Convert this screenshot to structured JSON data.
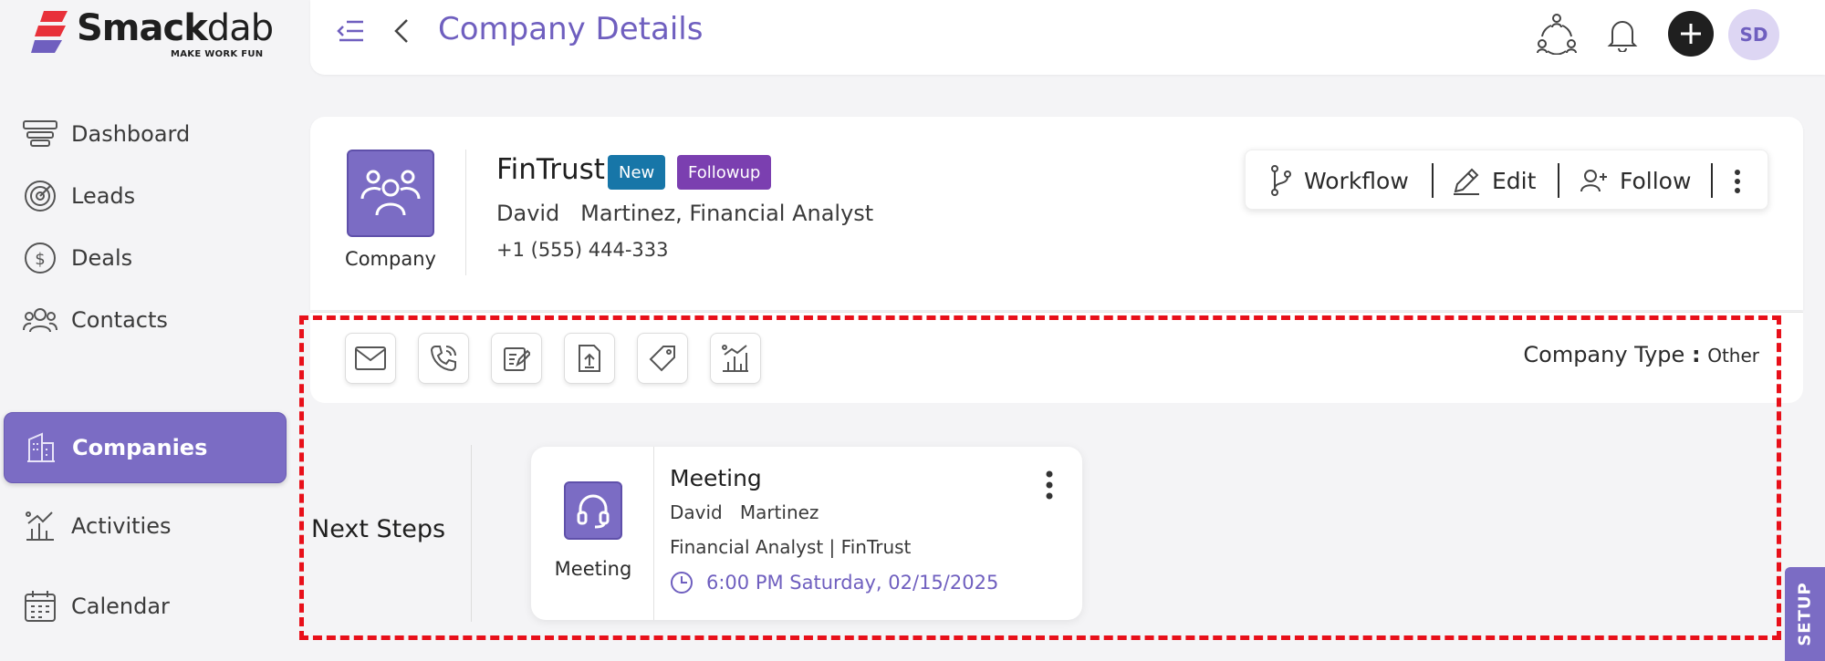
{
  "brand": {
    "name_bold": "Smack",
    "name_light": "dab",
    "tagline": "MAKE WORK FUN",
    "colors": {
      "accent": "#7b6cc4",
      "logo_red": "#e8313a",
      "logo_purple": "#6f5fbf"
    }
  },
  "sidebar": {
    "items": [
      {
        "label": "Dashboard",
        "icon": "dashboard-icon"
      },
      {
        "label": "Leads",
        "icon": "target-icon"
      },
      {
        "label": "Deals",
        "icon": "dollar-icon"
      },
      {
        "label": "Contacts",
        "icon": "people-icon"
      },
      {
        "label": "Companies",
        "icon": "building-icon",
        "active": true
      },
      {
        "label": "Activities",
        "icon": "chart-icon"
      },
      {
        "label": "Calendar",
        "icon": "calendar-icon"
      }
    ]
  },
  "header": {
    "title": "Company Details",
    "avatar_initials": "SD"
  },
  "company": {
    "logo_label": "Company",
    "name": "FinTrust",
    "badges": [
      {
        "label": "New",
        "color": "#1776a8"
      },
      {
        "label": "Followup",
        "color": "#7b3fb0"
      }
    ],
    "contact": "David   Martinez, Financial Analyst",
    "phone": "+1 (555) 444-333"
  },
  "actions": {
    "workflow": "Workflow",
    "edit": "Edit",
    "follow": "Follow"
  },
  "quick_actions": [
    "email-icon",
    "phone-icon",
    "note-icon",
    "upload-icon",
    "tag-icon",
    "activity-icon"
  ],
  "company_type": {
    "label": "Company Type",
    "sep": ":",
    "value": "Other"
  },
  "next_steps": {
    "label": "Next Steps",
    "card": {
      "icon_label": "Meeting",
      "title": "Meeting",
      "person": "David   Martinez",
      "role": "Financial Analyst | FinTrust",
      "time": "6:00 PM Saturday, 02/15/2025"
    }
  },
  "setup_tab": "SETUP"
}
